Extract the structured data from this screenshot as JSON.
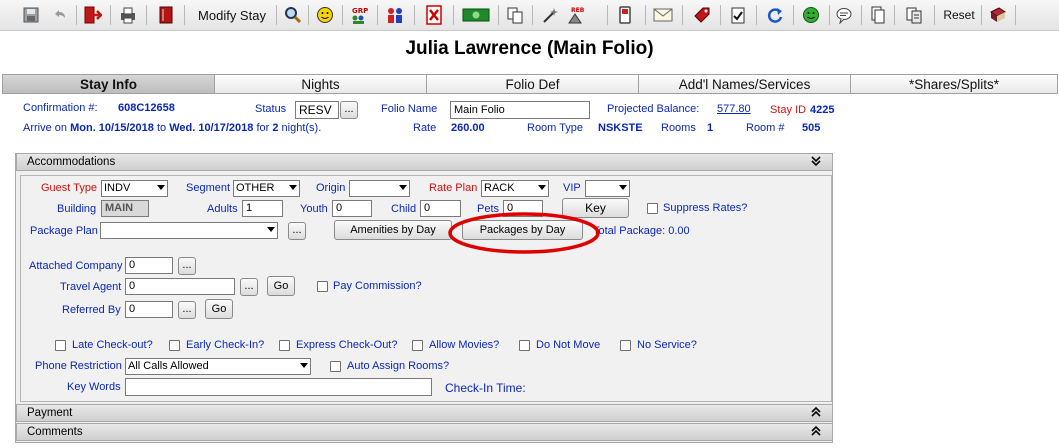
{
  "toolbar": {
    "modify_stay_label": "Modify Stay",
    "reset_label": "Reset",
    "icons": [
      "save-icon",
      "undo-icon",
      "exit-icon",
      "print-icon",
      "book-icon",
      "search-icon",
      "smiley-icon",
      "grp-icon",
      "guests-icon",
      "cancel-icon",
      "money-icon",
      "copy-icon",
      "magic-icon",
      "rebook-icon",
      "phone-icon",
      "email-icon",
      "tag-icon",
      "checklist-icon",
      "refresh-icon",
      "green-smiley-icon",
      "message-icon",
      "copy-document-icon",
      "duplicate-icon",
      "help-book-icon"
    ]
  },
  "title": "Julia Lawrence (Main Folio)",
  "tabs": [
    "Stay Info",
    "Nights",
    "Folio Def",
    "Add'l Names/Services",
    "*Shares/Splits*"
  ],
  "header": {
    "confirmation_label": "Confirmation #:",
    "confirmation_value": "608C12658",
    "status_label": "Status",
    "status_value": "RESV",
    "ellipsis": "...",
    "folio_name_label": "Folio Name",
    "folio_name_value": "Main Folio",
    "projected_balance_label": "Projected Balance:",
    "projected_balance_value": "577.80",
    "stay_id_label": "Stay ID",
    "stay_id_value": "4225",
    "arrive_prefix": "Arrive on",
    "arrive_date": "Mon. 10/15/2018",
    "to_text": "to",
    "depart_date": "Wed. 10/17/2018",
    "for_text": "for",
    "nights_count": "2",
    "nights_suffix": "night(s).",
    "rate_label": "Rate",
    "rate_value": "260.00",
    "room_type_label": "Room Type",
    "room_type_value": "NSKSTE",
    "rooms_label": "Rooms",
    "rooms_value": "1",
    "room_num_label": "Room #",
    "room_num_value": "505"
  },
  "accommodations": {
    "section_title": "Accommodations",
    "guest_type_label": "Guest Type",
    "guest_type_value": "INDV",
    "segment_label": "Segment",
    "segment_value": "OTHER",
    "origin_label": "Origin",
    "origin_value": "",
    "rate_plan_label": "Rate Plan",
    "rate_plan_value": "RACK",
    "vip_label": "VIP",
    "vip_value": "",
    "building_label": "Building",
    "building_value": "MAIN",
    "adults_label": "Adults",
    "adults_value": "1",
    "youth_label": "Youth",
    "youth_value": "0",
    "child_label": "Child",
    "child_value": "0",
    "pets_label": "Pets",
    "pets_value": "0",
    "key_button": "Key",
    "suppress_rates_label": "Suppress Rates?",
    "package_plan_label": "Package Plan",
    "package_plan_value": "",
    "amenities_button": "Amenities by Day",
    "packages_button": "Packages by Day",
    "total_package_label": "Total Package:",
    "total_package_value": "0.00",
    "attached_company_label": "Attached Company",
    "attached_company_value": "0",
    "travel_agent_label": "Travel Agent",
    "travel_agent_value": "0",
    "go_button": "Go",
    "pay_commission_label": "Pay Commission?",
    "referred_by_label": "Referred By",
    "referred_by_value": "0",
    "late_checkout_label": "Late Check-out?",
    "early_checkin_label": "Early Check-In?",
    "express_checkout_label": "Express Check-Out?",
    "allow_movies_label": "Allow Movies?",
    "do_not_move_label": "Do Not Move",
    "no_service_label": "No Service?",
    "phone_restriction_label": "Phone Restriction",
    "phone_restriction_value": "All Calls Allowed",
    "auto_assign_label": "Auto Assign Rooms?",
    "key_words_label": "Key Words",
    "key_words_value": "",
    "checkin_time_label": "Check-In Time:"
  },
  "payment_title": "Payment",
  "comments_title": "Comments",
  "colors": {
    "accent_blue": "#0a27b8",
    "red": "#d01010",
    "highlight_circle": "#e00000"
  }
}
